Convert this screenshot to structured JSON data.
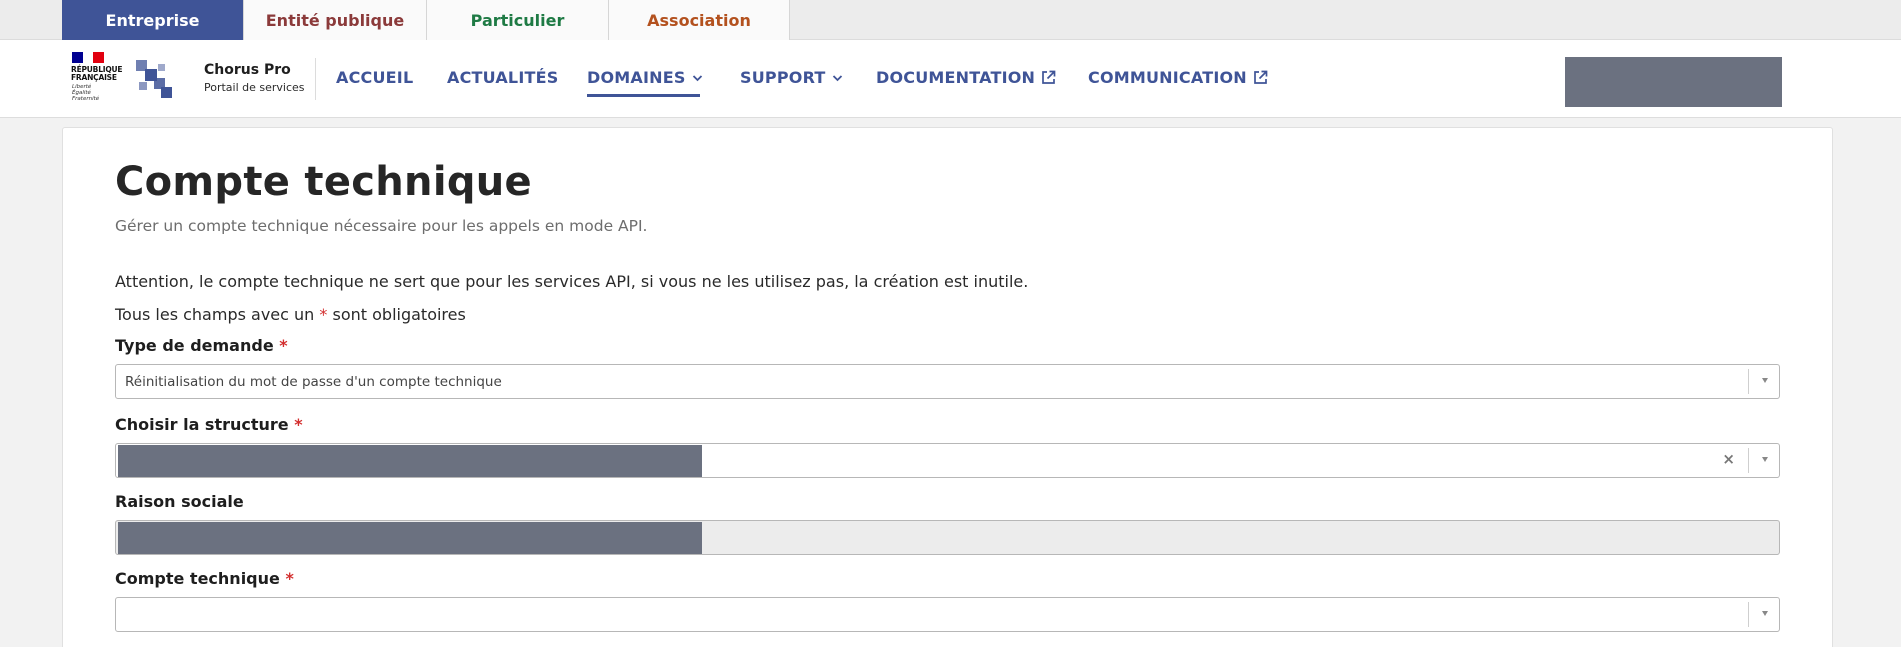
{
  "audience_tabs": [
    {
      "label": "Entreprise",
      "color": "#ffffff"
    },
    {
      "label": "Entité publique",
      "color": "#8b3a3a"
    },
    {
      "label": "Particulier",
      "color": "#1e7a44"
    },
    {
      "label": "Association",
      "color": "#b3511e"
    }
  ],
  "header": {
    "republique_line1": "RÉPUBLIQUE",
    "republique_line2": "FRANÇAISE",
    "motto_1": "Liberté",
    "motto_2": "Égalité",
    "motto_3": "Fraternité",
    "brand_title": "Chorus Pro",
    "brand_subtitle": "Portail de services",
    "nav": [
      {
        "label": "ACCUEIL"
      },
      {
        "label": "ACTUALITÉS"
      },
      {
        "label": "DOMAINES"
      },
      {
        "label": "SUPPORT"
      },
      {
        "label": "DOCUMENTATION"
      },
      {
        "label": "COMMUNICATION"
      }
    ]
  },
  "page": {
    "title": "Compte technique",
    "subtitle": "Gérer un compte technique nécessaire pour les appels en mode API.",
    "notice": "Attention, le compte technique ne sert que pour les services API, si vous ne les utilisez pas, la création est inutile.",
    "required_prefix": "Tous les champs avec un",
    "required_star": "*",
    "required_suffix": "sont obligatoires"
  },
  "form": {
    "type_demande": {
      "label": "Type de demande",
      "star": "*",
      "value": "Réinitialisation du mot de passe d'un compte technique"
    },
    "structure": {
      "label": "Choisir la structure",
      "star": "*",
      "clear": "×"
    },
    "raison_sociale": {
      "label": "Raison sociale"
    },
    "compte_technique": {
      "label": "Compte technique",
      "star": "*",
      "value": ""
    }
  },
  "colors": {
    "primary": "#3f5497",
    "required": "#d32f2f",
    "redaction": "#6b7180"
  }
}
